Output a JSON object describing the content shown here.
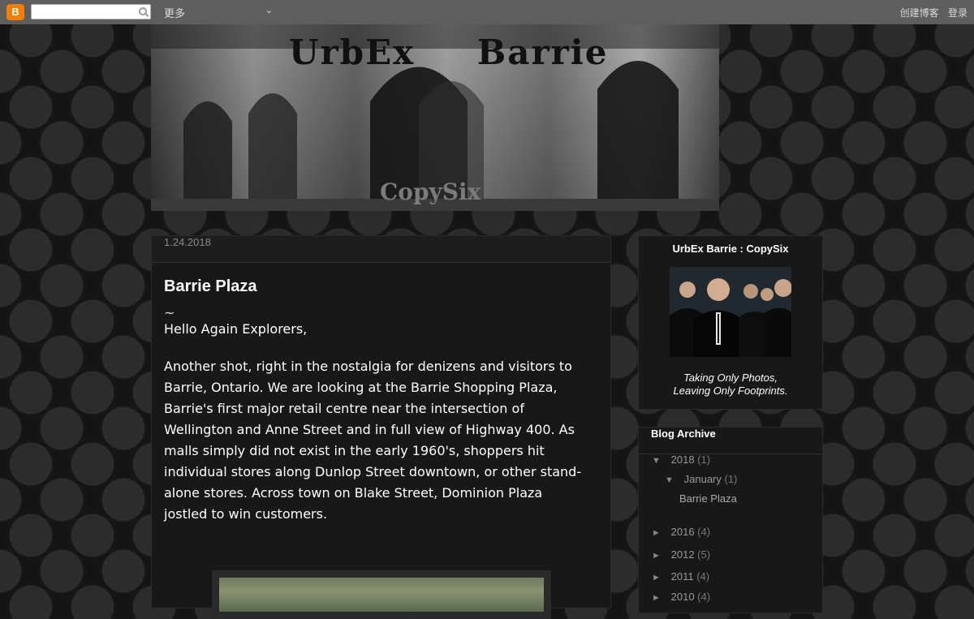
{
  "navbar": {
    "logo_letter": "B",
    "more_label": "更多",
    "create_blog": "创建博客",
    "login": "登录"
  },
  "header": {
    "title": "UrbEx Barrie",
    "subtitle": "CopySix"
  },
  "post": {
    "date": "1.24.2018",
    "title": "Barrie Plaza",
    "tilde": "~",
    "greeting": "Hello Again Explorers,",
    "paragraph": "Another shot, right in the nostalgia for denizens and visitors to Barrie, Ontario.  We are looking at the Barrie Shopping Plaza, Barrie's first major retail centre near the intersection of Wellington and Anne Street and in full view of Highway 400.  As malls simply did not exist in the early 1960's, shoppers hit individual stores along Dunlop Street downtown, or other stand-alone stores.  Across town on Blake Street, Dominion Plaza jostled to win customers."
  },
  "profile": {
    "title": "UrbEx Barrie : CopySix",
    "caption_line1": "Taking Only Photos,",
    "caption_line2": "Leaving Only Footprints."
  },
  "archive": {
    "title": "Blog Archive",
    "years": [
      {
        "year": "2018",
        "count": "(1)",
        "expanded": true
      },
      {
        "year": "2016",
        "count": "(4)",
        "expanded": false
      },
      {
        "year": "2012",
        "count": "(5)",
        "expanded": false
      },
      {
        "year": "2011",
        "count": "(4)",
        "expanded": false
      },
      {
        "year": "2010",
        "count": "(4)",
        "expanded": false
      }
    ],
    "month": {
      "name": "January",
      "count": "(1)"
    },
    "post_link": "Barrie Plaza",
    "expanded_glyph": "▼",
    "collapsed_glyph": "►"
  },
  "colors": {
    "navbar": "#5e5e5e",
    "blogger_orange": "#f57d00",
    "panel_bg": "#181818"
  }
}
